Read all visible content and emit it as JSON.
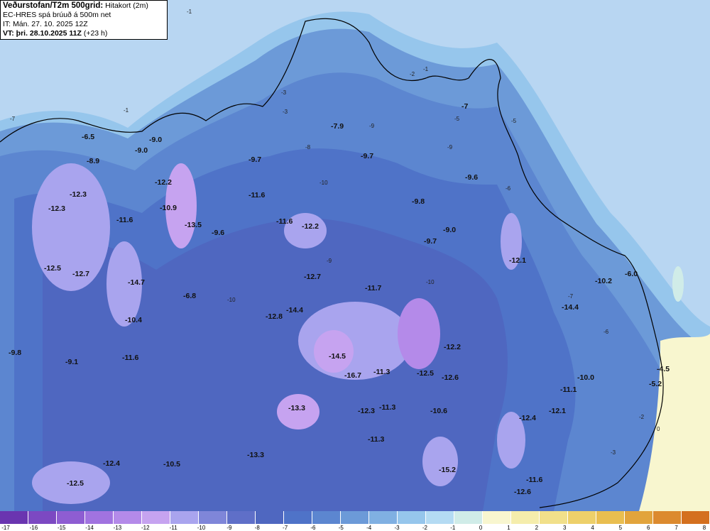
{
  "header": {
    "title": "Veðurstofan/T2m 500grid:",
    "title_suffix": "Hitakort (2m)",
    "line2": "EC-HRES spá brúuð á 500m net",
    "line3": "IT: Mán. 27. 10. 2025 12Z",
    "line4_bold": "VT: þri. 28.10.2025 11Z",
    "line4_rest": "(+23 h)"
  },
  "colors": {
    "sea": "#b8d6f2",
    "scale": [
      "#6a35b0",
      "#7c49c2",
      "#8e5dd2",
      "#a173e0",
      "#b48ae9",
      "#c6a3f0",
      "#a9a4ee",
      "#7f86d9",
      "#5f6fc8",
      "#4f67c0",
      "#4f73c8",
      "#5c86d0",
      "#6c9ad8",
      "#80b0e2",
      "#96c6ec",
      "#b4dbf3",
      "#d0ece8",
      "#f8f6cf",
      "#f5edac",
      "#f1e08a",
      "#edd06a",
      "#e9be50",
      "#e2a43c",
      "#dc8a2e",
      "#d4701f"
    ]
  },
  "map": {
    "station_labels": [
      {
        "text": "-6.5"
      },
      {
        "text": "-9.0"
      },
      {
        "text": "-9.0"
      },
      {
        "text": "-8.9"
      },
      {
        "text": "-12.3"
      },
      {
        "text": "-12.3"
      },
      {
        "text": "-12.2"
      },
      {
        "text": "-10.9"
      },
      {
        "text": "-11.6"
      },
      {
        "text": "-13.5"
      },
      {
        "text": "-9.6"
      },
      {
        "text": "-12.5"
      },
      {
        "text": "-12.7"
      },
      {
        "text": "-14.7"
      },
      {
        "text": "-6.8"
      },
      {
        "text": "-10.4"
      },
      {
        "text": "-9.8"
      },
      {
        "text": "-9.1"
      },
      {
        "text": "-11.6"
      },
      {
        "text": "-7.9"
      },
      {
        "text": "-9.7"
      },
      {
        "text": "-9.7"
      },
      {
        "text": "-11.6"
      },
      {
        "text": "-11.6"
      },
      {
        "text": "-12.2"
      },
      {
        "text": "-9.8"
      },
      {
        "text": "-9.6"
      },
      {
        "text": "-9.0"
      },
      {
        "text": "-9.7"
      },
      {
        "text": "-12.7"
      },
      {
        "text": "-11.7"
      },
      {
        "text": "-12.8"
      },
      {
        "text": "-14.4"
      },
      {
        "text": "-14.5"
      },
      {
        "text": "-16.7"
      },
      {
        "text": "-11.3"
      },
      {
        "text": "-12.5"
      },
      {
        "text": "-12.2"
      },
      {
        "text": "-12.6"
      },
      {
        "text": "-13.3"
      },
      {
        "text": "-12.3"
      },
      {
        "text": "-11.3"
      },
      {
        "text": "-10.6"
      },
      {
        "text": "-11.3"
      },
      {
        "text": "-13.3"
      },
      {
        "text": "-12.4"
      },
      {
        "text": "-10.5"
      },
      {
        "text": "-12.5"
      },
      {
        "text": "-15.2"
      },
      {
        "text": "-12.4"
      },
      {
        "text": "-12.6"
      },
      {
        "text": "-11.6"
      },
      {
        "text": "-12.1"
      },
      {
        "text": "-6.0"
      },
      {
        "text": "-10.2"
      },
      {
        "text": "-14.4"
      },
      {
        "text": "-10.0"
      },
      {
        "text": "-11.1"
      },
      {
        "text": "-12.1"
      },
      {
        "text": "-4.5"
      },
      {
        "text": "-5.2"
      },
      {
        "text": "-7"
      }
    ],
    "contour_labels": [
      "-1",
      "-2",
      "-3",
      "-5",
      "-6",
      "-7",
      "-8",
      "-9",
      "-10",
      "0"
    ]
  },
  "legend": {
    "ticks": [
      "-17",
      "-16",
      "-15",
      "-14",
      "-13",
      "-12",
      "-11",
      "-10",
      "-9",
      "-8",
      "-7",
      "-6",
      "-5",
      "-4",
      "-3",
      "-2",
      "-1",
      "0",
      "1",
      "2",
      "3",
      "4",
      "5",
      "6",
      "7",
      "8"
    ]
  }
}
